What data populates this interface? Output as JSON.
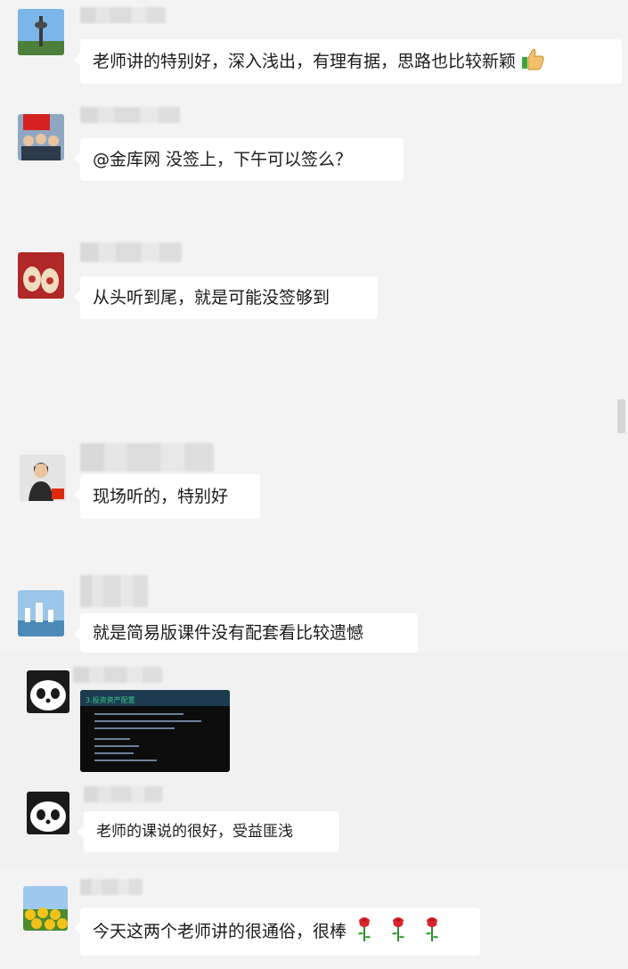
{
  "messages": [
    {
      "text": "老师讲的特别好，深入浅出，有理有据，思路也比较新颖",
      "emoji": "thumbs-up-icon"
    },
    {
      "text": "@金库网 没签上，下午可以签么？"
    },
    {
      "text": "从头听到尾，就是可能没签够到"
    },
    {
      "text": "现场听的，特别好"
    },
    {
      "text": "就是简易版课件没有配套看比较遗憾"
    },
    {
      "image": "lecture-slide-photo",
      "slide_title": "3.投资资产配置"
    },
    {
      "text": "老师的课说的很好，受益匪浅"
    },
    {
      "text": "今天这两个老师讲的很通俗，很棒",
      "emoji": "rose-icon",
      "emoji_count": 3
    }
  ],
  "colors": {
    "background": "#f3f3f3",
    "bubble": "#ffffff",
    "text": "#1b1b1b"
  }
}
